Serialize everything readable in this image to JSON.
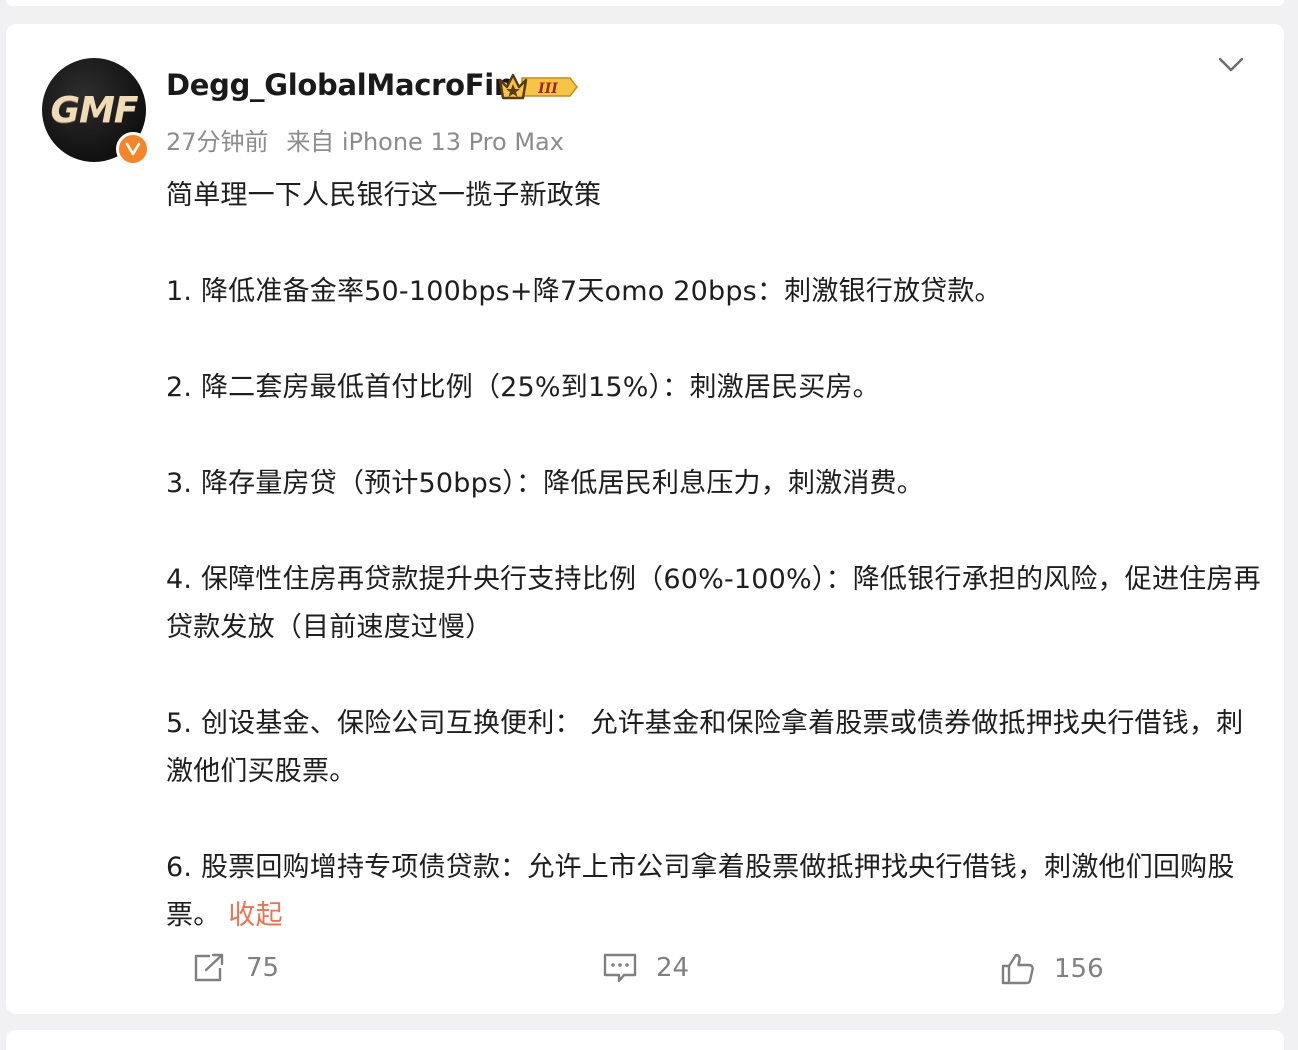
{
  "author": {
    "name": "Degg_GlobalMacroFin",
    "avatar_text": "GMF",
    "vip_level": "III",
    "time": "27分钟前",
    "source": "来自 iPhone 13 Pro Max"
  },
  "post": {
    "intro": "简单理一下人民银行这一揽子新政策",
    "items": [
      "1. 降低准备金率50-100bps+降7天omo 20bps：刺激银行放贷款。",
      "2. 降二套房最低首付比例（25%到15%）：刺激居民买房。",
      "3. 降存量房贷（预计50bps）：降低居民利息压力，刺激消费。",
      "4. 保障性住房再贷款提升央行支持比例（60%-100%）：降低银行承担的风险，促进住房再贷款发放（目前速度过慢）",
      "5. 创设基金、保险公司互换便利： 允许基金和保险拿着股票或债券做抵押找央行借钱，刺激他们买股票。",
      "6. 股票回购增持专项债贷款：允许上市公司拿着股票做抵押找央行借钱，刺激他们回购股票。"
    ],
    "collapse_label": "收起"
  },
  "actions": {
    "repost_count": "75",
    "comment_count": "24",
    "like_count": "156"
  },
  "colors": {
    "link": "#eb7350",
    "verified": "#f6852a",
    "meta": "#8c8c8c",
    "background": "#f1f1f3"
  },
  "icons": [
    "chevron-down-icon",
    "verified-icon",
    "vip-crown-icon",
    "repost-icon",
    "comment-icon",
    "like-icon"
  ]
}
